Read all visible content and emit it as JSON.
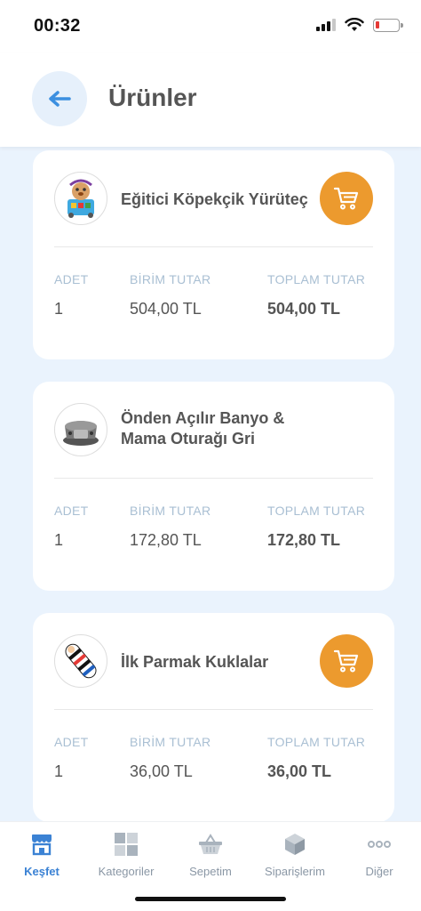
{
  "status_bar": {
    "time": "00:32"
  },
  "header": {
    "title": "Ürünler",
    "back_icon": "arrow-left-icon"
  },
  "columns": {
    "qty_label": "ADET",
    "unit_label": "BİRİM TUTAR",
    "total_label": "TOPLAM TUTAR"
  },
  "products": [
    {
      "name": "Eğitici Köpekçik Yürüteç",
      "qty": "1",
      "unit_price": "504,00 TL",
      "total_price": "504,00 TL",
      "has_cart_button": true
    },
    {
      "name": "Önden Açılır Banyo & Mama Oturağı Gri",
      "qty": "1",
      "unit_price": "172,80 TL",
      "total_price": "172,80 TL",
      "has_cart_button": false
    },
    {
      "name": "İlk Parmak Kuklalar",
      "qty": "1",
      "unit_price": "36,00 TL",
      "total_price": "36,00 TL",
      "has_cart_button": true
    }
  ],
  "tab_bar": {
    "tabs": [
      {
        "label": "Keşfet",
        "icon": "store-icon",
        "active": true
      },
      {
        "label": "Kategoriler",
        "icon": "grid-icon",
        "active": false
      },
      {
        "label": "Sepetim",
        "icon": "basket-icon",
        "active": false
      },
      {
        "label": "Siparişlerim",
        "icon": "box-icon",
        "active": false
      },
      {
        "label": "Diğer",
        "icon": "more-icon",
        "active": false
      }
    ]
  },
  "colors": {
    "accent": "#3b82d4",
    "cart": "#ec9a2e",
    "background": "#eaf3fd"
  }
}
